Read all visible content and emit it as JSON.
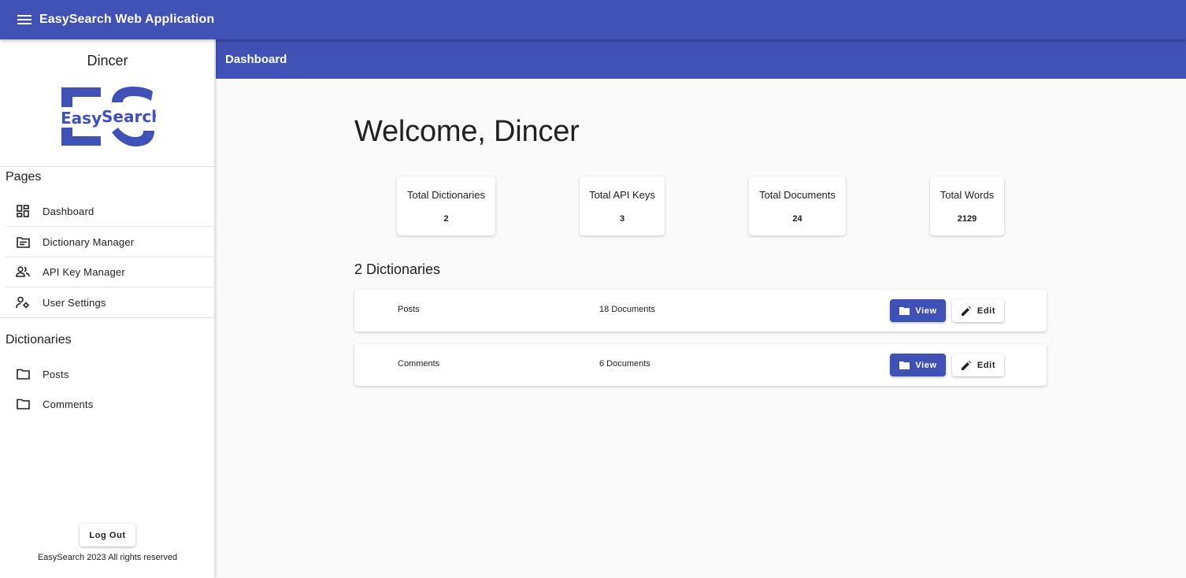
{
  "app": {
    "title": "EasySearch Web Application",
    "menu_icon": "menu-icon",
    "brand_color": "#3f51b5"
  },
  "sidebar": {
    "user_name": "Dincer",
    "logo": {
      "line1": "Easy",
      "line2": "Search",
      "letters": "ES"
    },
    "pages_title": "Pages",
    "pages": [
      {
        "label": "Dashboard",
        "icon": "dashboard-icon"
      },
      {
        "label": "Dictionary Manager",
        "icon": "folder-list-icon"
      },
      {
        "label": "API Key Manager",
        "icon": "people-icon"
      },
      {
        "label": "User Settings",
        "icon": "user-settings-icon"
      }
    ],
    "dictionaries_title": "Dictionaries",
    "dictionaries": [
      {
        "label": "Posts",
        "icon": "folder-icon"
      },
      {
        "label": "Comments",
        "icon": "folder-icon"
      }
    ],
    "logout_label": "Log Out",
    "copyright": "EasySearch 2023 All rights reserved"
  },
  "page": {
    "title": "Dashboard",
    "welcome": "Welcome, Dincer"
  },
  "stats": [
    {
      "label": "Total Dictionaries",
      "value": "2"
    },
    {
      "label": "Total API Keys",
      "value": "3"
    },
    {
      "label": "Total Documents",
      "value": "24"
    },
    {
      "label": "Total Words",
      "value": "2129"
    }
  ],
  "dictionaries_section": {
    "heading": "2 Dictionaries",
    "items": [
      {
        "name": "Posts",
        "docs": "18 Documents",
        "view_label": "View",
        "edit_label": "Edit"
      },
      {
        "name": "Comments",
        "docs": "6 Documents",
        "view_label": "View",
        "edit_label": "Edit"
      }
    ]
  }
}
